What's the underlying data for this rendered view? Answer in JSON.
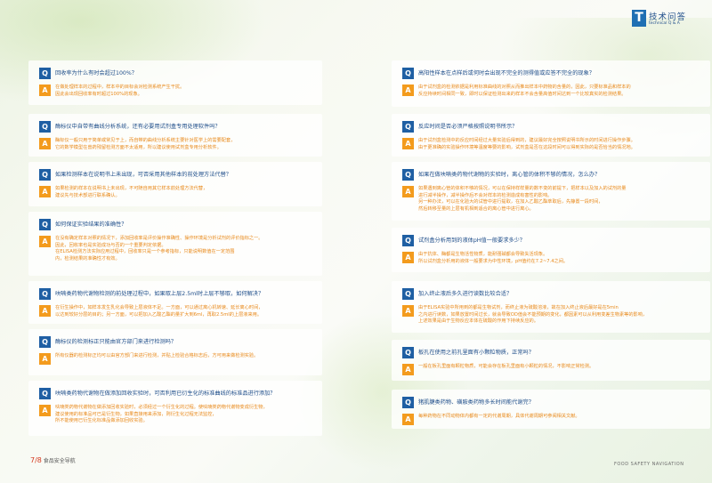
{
  "header": {
    "logo_letter": "T",
    "title": "技术问答",
    "subtitle": "technical Q & A"
  },
  "footer": {
    "page_num": "7/8",
    "left_label": "食品安全导航",
    "right_label": "FOOD SAFETY NAVIGATION"
  },
  "left": [
    {
      "q": "回收率为什么有时会超过100%？",
      "a": [
        "在做处理样本的过程中，样本中的目标会对检测系统产生干扰。",
        "因此会出现回收率有时超过100%的现象。"
      ]
    },
    {
      "q": "酶标仪中自带有曲线分析系统，还有必要用试剂盒专用处理软件吗？",
      "a": [
        "酶标仪一般只用于简单或常见于上，而自带的曲线分析系统主要针对医学上的需要配套，",
        "它的数学模型在兽药残留检测方面不太适用，所以建议使用试剂盒专用分析软件。"
      ]
    },
    {
      "q": "如果检测样本在说明书上未出现，可否采用其他样本的前处理方法代替？",
      "a": [
        "如果检测的样本在说明书上未出现，不可随自用其它样本前处理方法代替，",
        "建议先与技术部进行联系确认。"
      ]
    },
    {
      "q": "如何保证实验结果的准确性？",
      "a": [
        "在没有确定样本对照的情况下，添加回收率是评价操作准确性、操作环境是分析试剂的评价指标之一。",
        "因此，回收率也是实验成功与否的一个重要判定依据。",
        "在ELISA检测方法实际应用过程中，回收率只是一个参考指标，只能说明数值在一定范围",
        "内，检测结果的准确性才有效。"
      ]
    },
    {
      "q": "呋喃类药物代谢物检测的前处理过程中，如果取上层2.5ml时上层不够取，如何解决？",
      "a": [
        "在衍生操作中，如样本发生乳化会导致上层液体不足。一方面，可以通过离心机转速、延长离心时间，",
        "以达到较好分层的目的；另一方面，可以把加入乙酸乙酯的量扩大到6ml，再取2.5ml的上层液来用。"
      ]
    },
    {
      "q": "酶标仪的检测标正只能由官方部门来进行检测吗？",
      "a": [
        "所有仪器的检测标正均可以由官方部门来进行检测，并贴上检验合格标志后，方可用来做检测实验。"
      ]
    },
    {
      "q": "呋喃类药物代谢物在做添加回收实验时，可否利用已衍生化的标准曲线的标准品进行添加？",
      "a": [
        "呋喃类药物代谢物在做添加回收实验时，必须经过一个衍生化的过程。使呋喃类药物代谢物变成衍生物，",
        "建议使用的标准品可已是衍生物，如果直接用来添加，则衍生化过程无法监控，",
        "所不能使用已衍生化标准品做添加回收实验。"
      ]
    }
  ],
  "right": [
    {
      "q": "高阳性样本在点样后或何时会出现不完全的测得值或应答不完全的现象？",
      "a": [
        "由于试剂盒的检测依据是利用标准曲线的对照从而推出样本中药物的含量的，因此，只要标准品和样本的",
        "反应持续时间相同一致，即时以保证检测出来的样本不会含量高值时间达到一个比较真实的检测结果。"
      ]
    },
    {
      "q": "反应时间是否必须严格按照说明书所示？",
      "a": [
        "由于试剂盒检测中的反应时间经过大量实验后得到的，建议最好完全按照说明书所示的时间进行操作步骤。",
        "由于更准确的实验操作环境等温度等要的影响，试剂盒是否在这段时间可以得到实际的是否恰当的情况地。"
      ]
    },
    {
      "q": "如果在做呋喃类药物代谢物的实验时，离心管的体积不够的情况，怎么办？",
      "a": [
        "如果遇到离心管的体积不够的情况，可以在保持样样量的数不变的前提下，把样本以及加入的试剂的量",
        "进行减半操作，减半操作后不会对样本的检测造成有害性的影响。",
        "另一种办法，可以在化验大的试管中进行提取，在加入乙酸乙酯萃取后，先静置一段时间，",
        "然后转移至量的上层有机相到适合的离心管中进行离心。"
      ]
    },
    {
      "q": "试剂盒分析用到的液体pH值一般要求多少？",
      "a": [
        "由于抗体、酶都是生物活性物质，能耐强碱都会导致失活现象。",
        "所以试剂盒分析用的液体一般要求为中性环境，pH值约在7.2~7.4之间。"
      ]
    },
    {
      "q": "加入终止液后多久进行读数比较合适？",
      "a": [
        "由于ELISA实验中所用到的都是生物试剂，而终止液为硫酸溶液，故在加入终止液后最好是在5min",
        "之内进行读数，如果放置时间过长，就会导致OD值会不能预期的变化，都因素可以从利用变差生物素等的影响，",
        "上述效果是由于生物反应本体在硫酸的作用下持续反应的。"
      ]
    },
    {
      "q": "板孔在使用之前孔里面有小颗粒物质，正常吗？",
      "a": [
        "一般在板孔里面有颗粒物质，可能会存在板孔里面有小颗粒的情况，不影响正常检测。"
      ]
    },
    {
      "q": "猪肌腱类药物、磺胺类药物多长时间能代谢完？",
      "a": [
        "每种药物在不同动物体内都有一定的代谢周期，具体代谢周期可参阅相关文献。"
      ]
    }
  ]
}
